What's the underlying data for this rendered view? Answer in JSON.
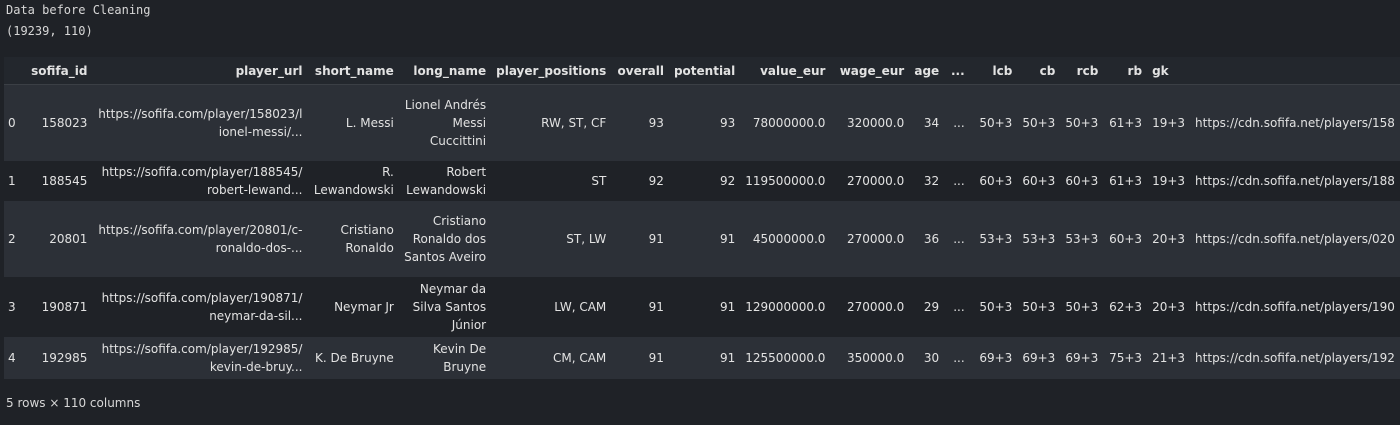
{
  "output": {
    "title_line": "Data before Cleaning",
    "shape_line": "(19239, 110)"
  },
  "table": {
    "columns": [
      "",
      "sofifa_id",
      "player_url",
      "short_name",
      "long_name",
      "player_positions",
      "overall",
      "potential",
      "value_eur",
      "wage_eur",
      "age",
      "...",
      "lcb",
      "cb",
      "rcb",
      "rb",
      "gk",
      ""
    ],
    "rows": [
      {
        "index": "0",
        "sofifa_id": "158023",
        "player_url": "https://sofifa.com/player/158023/lionel-messi/...",
        "short_name": "L. Messi",
        "long_name": "Lionel Andrés Messi Cuccittini",
        "player_positions": "RW, ST, CF",
        "overall": "93",
        "potential": "93",
        "value_eur": "78000000.0",
        "wage_eur": "320000.0",
        "age": "34",
        "ellipsis": "...",
        "lcb": "50+3",
        "cb": "50+3",
        "rcb": "50+3",
        "rb": "61+3",
        "gk": "19+3",
        "face_url": "https://cdn.sofifa.net/players/158"
      },
      {
        "index": "1",
        "sofifa_id": "188545",
        "player_url": "https://sofifa.com/player/188545/robert-lewand...",
        "short_name": "R. Lewandowski",
        "long_name": "Robert Lewandowski",
        "player_positions": "ST",
        "overall": "92",
        "potential": "92",
        "value_eur": "119500000.0",
        "wage_eur": "270000.0",
        "age": "32",
        "ellipsis": "...",
        "lcb": "60+3",
        "cb": "60+3",
        "rcb": "60+3",
        "rb": "61+3",
        "gk": "19+3",
        "face_url": "https://cdn.sofifa.net/players/188"
      },
      {
        "index": "2",
        "sofifa_id": "20801",
        "player_url": "https://sofifa.com/player/20801/c-ronaldo-dos-...",
        "short_name": "Cristiano Ronaldo",
        "long_name": "Cristiano Ronaldo dos Santos Aveiro",
        "player_positions": "ST, LW",
        "overall": "91",
        "potential": "91",
        "value_eur": "45000000.0",
        "wage_eur": "270000.0",
        "age": "36",
        "ellipsis": "...",
        "lcb": "53+3",
        "cb": "53+3",
        "rcb": "53+3",
        "rb": "60+3",
        "gk": "20+3",
        "face_url": "https://cdn.sofifa.net/players/020"
      },
      {
        "index": "3",
        "sofifa_id": "190871",
        "player_url": "https://sofifa.com/player/190871/neymar-da-sil...",
        "short_name": "Neymar Jr",
        "long_name": "Neymar da Silva Santos Júnior",
        "player_positions": "LW, CAM",
        "overall": "91",
        "potential": "91",
        "value_eur": "129000000.0",
        "wage_eur": "270000.0",
        "age": "29",
        "ellipsis": "...",
        "lcb": "50+3",
        "cb": "50+3",
        "rcb": "50+3",
        "rb": "62+3",
        "gk": "20+3",
        "face_url": "https://cdn.sofifa.net/players/190"
      },
      {
        "index": "4",
        "sofifa_id": "192985",
        "player_url": "https://sofifa.com/player/192985/kevin-de-bruy...",
        "short_name": "K. De Bruyne",
        "long_name": "Kevin De Bruyne",
        "player_positions": "CM, CAM",
        "overall": "91",
        "potential": "91",
        "value_eur": "125500000.0",
        "wage_eur": "350000.0",
        "age": "30",
        "ellipsis": "...",
        "lcb": "69+3",
        "cb": "69+3",
        "rcb": "69+3",
        "rb": "75+3",
        "gk": "21+3",
        "face_url": "https://cdn.sofifa.net/players/192"
      }
    ]
  },
  "footer": {
    "summary": "5 rows × 110 columns"
  },
  "colors": {
    "background": "#1f2227",
    "row_stripe": "#2c3037",
    "text": "#e2e2e2"
  }
}
